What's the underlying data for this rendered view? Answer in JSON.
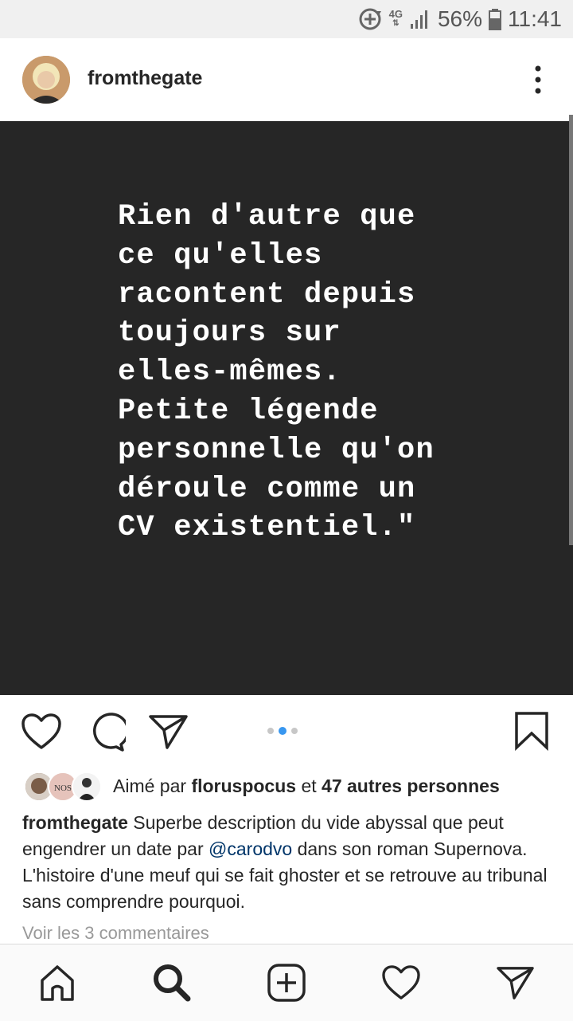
{
  "status_bar": {
    "network_type": "4G",
    "battery_percent": "56%",
    "time": "11:41"
  },
  "post": {
    "username": "fromthegate",
    "quote_lines": [
      "Rien d'autre que",
      "ce qu'elles",
      "racontent depuis",
      "toujours sur",
      "elles-mêmes.",
      "Petite légende",
      "personnelle qu'on",
      "déroule comme un",
      "CV existentiel.\""
    ],
    "carousel": {
      "total": 3,
      "active_index": 1
    },
    "likes": {
      "prefix": "Aimé par",
      "liker": "floruspocus",
      "conjunction": "et",
      "others": "47 autres personnes"
    },
    "caption": {
      "username": "fromthegate",
      "text_before": " Superbe description du vide abyssal que peut engendrer un date par ",
      "mention": "@carodvo",
      "text_after": " dans son roman Supernova. L'histoire d'une meuf qui se fait ghoster et se retrouve au tribunal sans comprendre pourquoi."
    },
    "view_comments": "Voir les 3 commentaires"
  },
  "icons": {
    "sync": "sync-icon",
    "signal": "signal-icon",
    "battery": "battery-icon",
    "more": "more-vertical-icon",
    "like": "heart-icon",
    "comment": "comment-icon",
    "share": "paper-plane-icon",
    "save": "bookmark-icon",
    "home": "home-icon",
    "search": "search-icon",
    "add": "add-post-icon",
    "activity": "heart-icon",
    "direct": "paper-plane-icon"
  }
}
